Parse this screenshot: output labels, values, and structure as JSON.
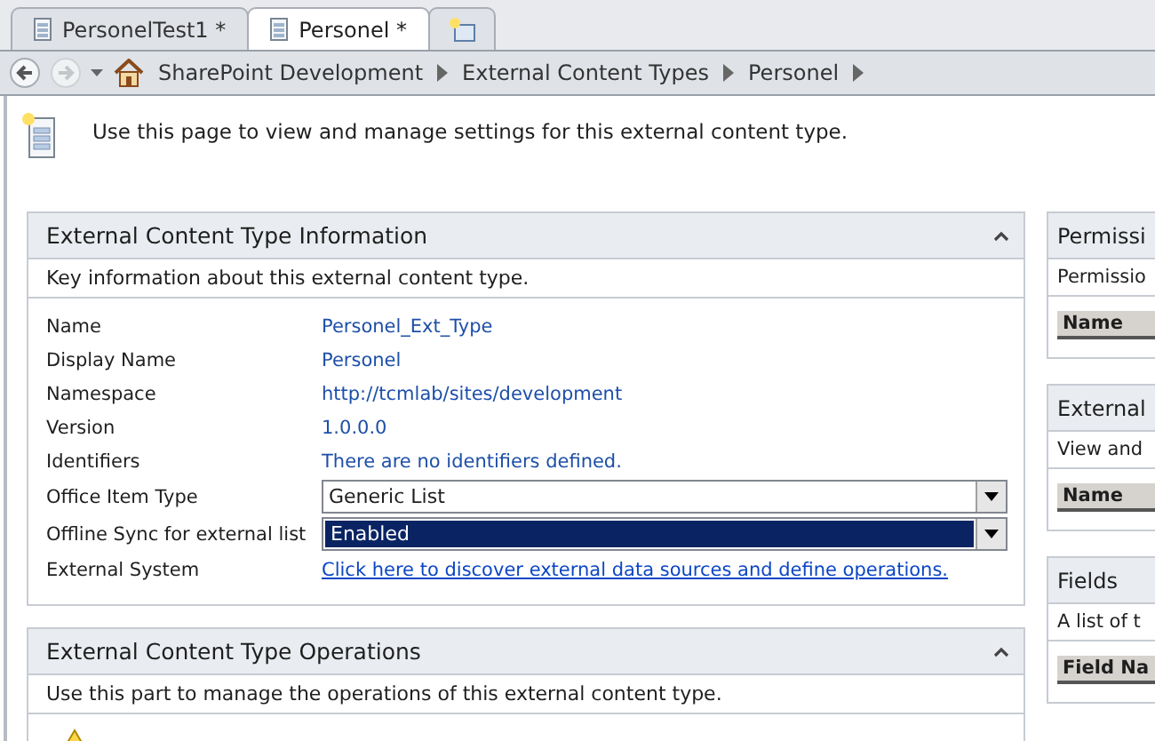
{
  "tabs": [
    {
      "label": "PersonelTest1 *",
      "selected": false
    },
    {
      "label": "Personel *",
      "selected": true
    }
  ],
  "breadcrumb": [
    "SharePoint Development",
    "External Content Types",
    "Personel"
  ],
  "intro": "Use this page to view and manage settings for this external content type.",
  "info_panel": {
    "title": "External Content Type Information",
    "description": "Key information about this external content type.",
    "rows": [
      {
        "label": "Name",
        "kind": "value",
        "value": "Personel_Ext_Type"
      },
      {
        "label": "Display Name",
        "kind": "value",
        "value": "Personel"
      },
      {
        "label": "Namespace",
        "kind": "value",
        "value": "http://tcmlab/sites/development"
      },
      {
        "label": "Version",
        "kind": "value",
        "value": "1.0.0.0"
      },
      {
        "label": "Identifiers",
        "kind": "value",
        "value": "There are no identifiers defined."
      },
      {
        "label": "Office Item Type",
        "kind": "select",
        "value": "Generic List",
        "focused": false
      },
      {
        "label": "Offline Sync for external list",
        "kind": "select",
        "value": "Enabled",
        "focused": true
      },
      {
        "label": "External System",
        "kind": "link",
        "value": "Click here to discover external data sources and define operations."
      }
    ]
  },
  "operations_panel": {
    "title": "External Content Type Operations",
    "description": "Use this part to manage the operations of this external content type."
  },
  "side_panels": [
    {
      "title": "Permissi",
      "description": "Permissio",
      "column": "Name"
    },
    {
      "title": "External",
      "description": "View and",
      "column": "Name"
    },
    {
      "title": "Fields",
      "description": "A list of t",
      "column": "Field Na"
    }
  ]
}
